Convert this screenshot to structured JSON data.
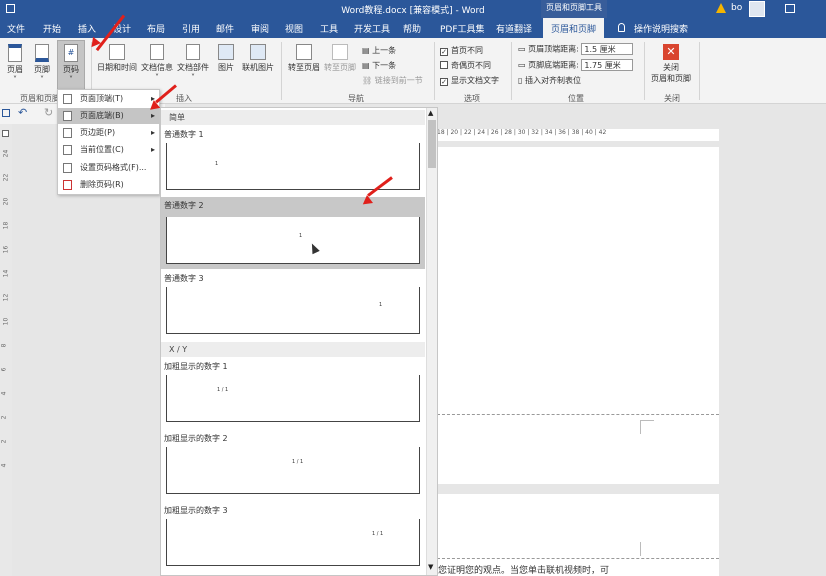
{
  "window": {
    "title": "Word教程.docx [兼容模式] - Word",
    "context_group": "页眉和页脚工具",
    "user": "bo",
    "warning_icon": "warning-icon",
    "colors": {
      "ribbon_blue": "#2b579a",
      "annotation_red": "#e0201b"
    }
  },
  "tabs": [
    {
      "label": "文件"
    },
    {
      "label": "开始"
    },
    {
      "label": "插入"
    },
    {
      "label": "设计"
    },
    {
      "label": "布局"
    },
    {
      "label": "引用"
    },
    {
      "label": "邮件"
    },
    {
      "label": "审阅"
    },
    {
      "label": "视图"
    },
    {
      "label": "工具"
    },
    {
      "label": "开发工具"
    },
    {
      "label": "帮助"
    },
    {
      "label": "PDF工具集"
    },
    {
      "label": "有道翻译"
    },
    {
      "label": "页眉和页脚"
    }
  ],
  "tell_me": "操作说明搜索",
  "ribbon": {
    "hf_group": {
      "header": "页眉",
      "footer": "页脚",
      "page_number": "页码",
      "label": "页眉和页脚"
    },
    "insert_group": {
      "datetime": "日期和时间",
      "docinfo": "文档信息",
      "quickparts": "文档部件",
      "picture": "图片",
      "online_picture": "联机图片",
      "label": "插入"
    },
    "nav_group": {
      "goto_header": "转至页眉",
      "goto_footer": "转至页脚",
      "prev": "上一条",
      "next": "下一条",
      "link_prev": "链接到前一节",
      "label": "导航"
    },
    "options_group": {
      "first_page": "首页不同",
      "odd_even": "奇偶页不同",
      "show_text": "显示文档文字",
      "label": "选项"
    },
    "position_group": {
      "header_dist_label": "页眉顶端距离:",
      "header_dist_value": "1.5 厘米",
      "footer_dist_label": "页脚底端距离:",
      "footer_dist_value": "1.75 厘米",
      "align_tab": "插入对齐制表位",
      "label": "位置"
    },
    "close_group": {
      "close_line1": "关闭",
      "close_line2": "页眉和页脚",
      "label": "关闭"
    }
  },
  "menu": {
    "items": [
      {
        "label": "页面顶端(T)"
      },
      {
        "label": "页面底端(B)"
      },
      {
        "label": "页边距(P)"
      },
      {
        "label": "当前位置(C)"
      },
      {
        "label": "设置页码格式(F)..."
      },
      {
        "label": "删除页码(R)"
      }
    ]
  },
  "gallery": {
    "section_simple": "简单",
    "section_xy": "X / Y",
    "items": [
      {
        "label": "普通数字 1",
        "sample": "1"
      },
      {
        "label": "普通数字 2",
        "sample": "1"
      },
      {
        "label": "普通数字 3",
        "sample": "1"
      },
      {
        "label": "加粗显示的数字 1",
        "sample": "1 / 1"
      },
      {
        "label": "加粗显示的数字 2",
        "sample": "1 / 1"
      },
      {
        "label": "加粗显示的数字 3",
        "sample": "1 / 1"
      }
    ]
  },
  "ruler": {
    "ticks": "18 | 20 | 22 | 24 | 26 | 28 | 30 | 32 | 34 | 36 | 38 | 40 | 42"
  },
  "vruler_ticks": [
    "24",
    "22",
    "20",
    "18",
    "16",
    "14",
    "12",
    "10",
    "8",
    "6",
    "4",
    "2",
    "2",
    "4"
  ],
  "document": {
    "body_text": "您证明您的观点。当您单击联机视频时，可"
  }
}
